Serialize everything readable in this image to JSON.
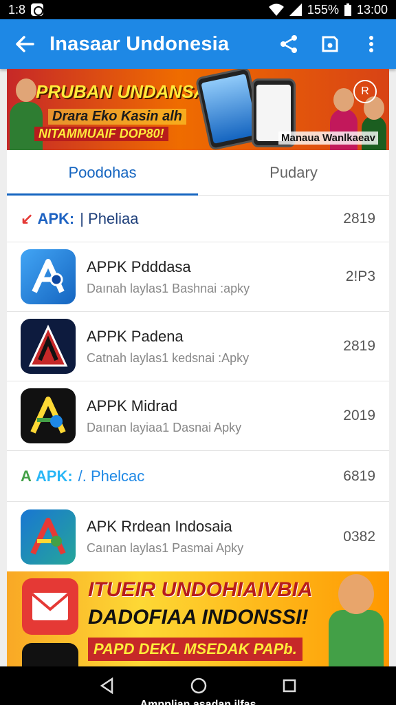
{
  "status_bar": {
    "time_left": "1:8",
    "battery": "155%",
    "clock": "13:00"
  },
  "app_bar": {
    "title": "Inasaar Undonesia",
    "icons": [
      "back-arrow-icon",
      "share-icon",
      "save-icon",
      "more-vert-icon"
    ]
  },
  "top_banner": {
    "title": "PRUBAN UNDANSA",
    "line2": "Drara Eko Kasin alh",
    "line3": "NITAMMUAIF DOP80!",
    "caption": "Manaua Wanlkaeav",
    "badge": "R"
  },
  "tabs": [
    {
      "label": "Poodohas",
      "active": true
    },
    {
      "label": "Pudary",
      "active": false
    }
  ],
  "list": [
    {
      "kind": "section",
      "logo": "↙",
      "apk": "APK:",
      "label": "| Pheliaa",
      "year": "2819",
      "logo_color": "#e53935"
    },
    {
      "kind": "app",
      "name": "APPK Pdddasa",
      "desc": "Daınah laylas1 Bashnai :apky",
      "year": "2!P3",
      "icon": "app-icon-blue-a"
    },
    {
      "kind": "app",
      "name": "APPK Padena",
      "desc": "Catnah laylas1 kedsnai :Apky",
      "year": "2819",
      "icon": "app-icon-red-a"
    },
    {
      "kind": "app",
      "name": "APPK Midrad",
      "desc": "Daınan layiaa1 Dasnai Apky",
      "year": "2019",
      "icon": "app-icon-black-a"
    },
    {
      "kind": "section",
      "logo": "A",
      "apk": "APK:",
      "label": "/. Phelcac",
      "year": "6819",
      "logo_color": "#43a047"
    },
    {
      "kind": "app",
      "name": "APK Rrdean Indosaia",
      "desc": "Caınan laylas1 Pasmai Apky",
      "year": "0382",
      "icon": "app-icon-colorful-a"
    }
  ],
  "bottom_banner": {
    "line1": "ITUEIR UNDOHIAIVBIA",
    "line2": "DADOFIAA INDONSSI!",
    "line3": "PAPD DEKL MSEDAK PAPb."
  },
  "nav_bar": {
    "icons": [
      "back-triangle-icon",
      "home-circle-icon",
      "recents-square-icon"
    ],
    "caption": "Ampplian asadan ilfas"
  },
  "colors": {
    "app_bar": "#1e88e5",
    "tab_active": "#1565c0",
    "banner_top": "#c62828",
    "banner_bottom": "#fdd835"
  }
}
